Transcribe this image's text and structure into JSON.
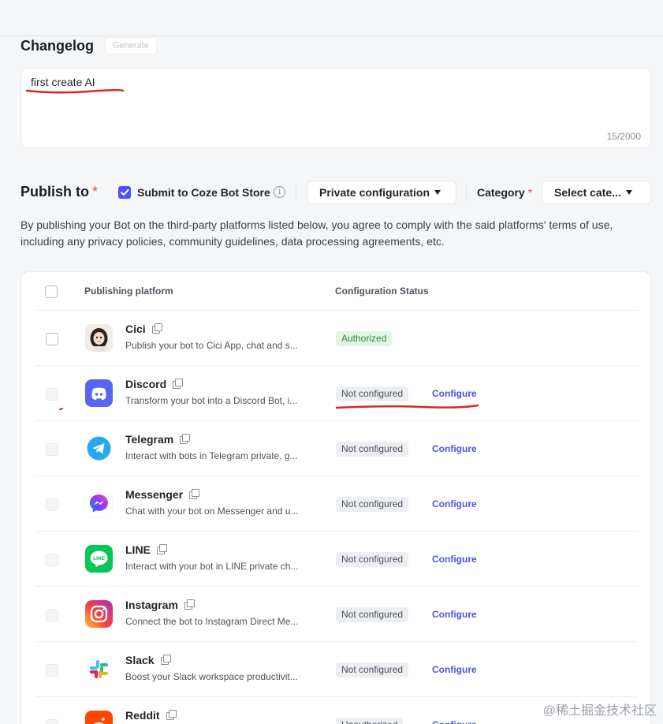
{
  "changelog": {
    "title": "Changelog",
    "generate_label": "Generate",
    "value": "first create AI",
    "counter": "15/2000"
  },
  "publish": {
    "title": "Publish to",
    "required_mark": "*",
    "store_label": "Submit to Coze Bot Store",
    "store_checked": true,
    "info_glyph": "i",
    "private_select": "Private configuration",
    "category_label": "Category",
    "category_required": "*",
    "category_select": "Select cate..."
  },
  "disclaimer": "By publishing your Bot on the third-party platforms listed below, you agree to comply with the said platforms' terms of use, including any privacy policies, community guidelines, data processing agreements, etc.",
  "table": {
    "col_platform": "Publishing platform",
    "col_status": "Configuration Status",
    "rows": [
      {
        "name": "Cici",
        "desc": "Publish your bot to Cici App, chat and s...",
        "status": "Authorized",
        "status_type": "auth",
        "action": "",
        "disabled": false,
        "icon": "cici-avatar-icon"
      },
      {
        "name": "Discord",
        "desc": "Transform your bot into a Discord Bot, i...",
        "status": "Not configured",
        "status_type": "notcfg",
        "action": "Configure",
        "disabled": true,
        "icon": "discord-icon"
      },
      {
        "name": "Telegram",
        "desc": "Interact with bots in Telegram private, g...",
        "status": "Not configured",
        "status_type": "notcfg",
        "action": "Configure",
        "disabled": true,
        "icon": "telegram-icon"
      },
      {
        "name": "Messenger",
        "desc": "Chat with your bot on Messenger and u...",
        "status": "Not configured",
        "status_type": "notcfg",
        "action": "Configure",
        "disabled": true,
        "icon": "messenger-icon"
      },
      {
        "name": "LINE",
        "desc": "Interact with your bot in LINE private ch...",
        "status": "Not configured",
        "status_type": "notcfg",
        "action": "Configure",
        "disabled": true,
        "icon": "line-icon"
      },
      {
        "name": "Instagram",
        "desc": "Connect the bot to Instagram Direct Me...",
        "status": "Not configured",
        "status_type": "notcfg",
        "action": "Configure",
        "disabled": true,
        "icon": "instagram-icon"
      },
      {
        "name": "Slack",
        "desc": "Boost your Slack workspace productivit...",
        "status": "Not configured",
        "status_type": "notcfg",
        "action": "Configure",
        "disabled": true,
        "icon": "slack-icon"
      },
      {
        "name": "Reddit",
        "desc": "",
        "status": "Unauthorized",
        "status_type": "notcfg",
        "action": "Configure",
        "disabled": true,
        "icon": "reddit-icon"
      }
    ]
  },
  "logos": {
    "LINE": "LINE"
  },
  "watermark": "@稀土掘金技术社区",
  "colors": {
    "accent": "#4d53e8",
    "authorized_bg": "#e3f6e4",
    "authorized_text": "#2d8a3e",
    "annotation_red": "#d9281e"
  }
}
